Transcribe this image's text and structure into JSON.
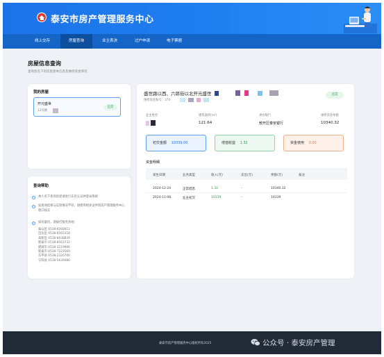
{
  "header": {
    "site_title": "泰安市房产管理服务中心"
  },
  "nav": {
    "items": [
      {
        "label": "线上交存"
      },
      {
        "label": "房屋查询",
        "active": true
      },
      {
        "label": "业主表决"
      },
      {
        "label": "过户申请"
      },
      {
        "label": "电子票据"
      }
    ]
  },
  "page": {
    "title": "房屋信息查询",
    "subtitle": "查询您名下的房屋基本信息及维修资金情况"
  },
  "my_houses": {
    "title": "我的房屋",
    "items": [
      {
        "name": "开元盛世",
        "sub": "12号楼",
        "status": "已交"
      }
    ]
  },
  "help": {
    "title": "查询帮助",
    "tips": [
      "本人名下查询房屋请进行实名认证并登录系统",
      "如查询结果与实际情况不符，请携带相关证件到房产管理服务中心窗口核实",
      "如有疑问，请拨打服务热线："
    ],
    "phones": [
      "泰山区 0538-6268811",
      "岱岳区 0538-8565358",
      "高新区 0538-8938839",
      "新泰市 0538-8563732",
      "肥城市 0538-3219986",
      "新泰市 0538-7223569",
      "东平县 0538-2320766",
      "宁阳县 0538-5639086"
    ]
  },
  "detail": {
    "address": "盛世路以西、六郎街以北开元盛世",
    "account_label": "维修资金账号：370",
    "status": "已交",
    "fields": [
      {
        "label": "业主姓名",
        "value": ""
      },
      {
        "label": "建筑面积(m²)",
        "value": "121.64"
      },
      {
        "label": "承办银行",
        "value": "敖开区泰安银行"
      },
      {
        "label": "维修资金余额",
        "value": "10340.32"
      }
    ],
    "stats": [
      {
        "label": "初交金额",
        "value": "10339.00",
        "color": "#1b73e8"
      },
      {
        "label": "增值收益",
        "value": "1.32",
        "color": "#2b9a4e"
      },
      {
        "label": "资金使用",
        "value": "0.00",
        "color": "#e8753b"
      }
    ]
  },
  "ledger": {
    "title": "资金明细",
    "headers": [
      "发生日期",
      "业务类型",
      "收入(元)",
      "支出(元)",
      "余额(元)",
      "备注"
    ],
    "rows": [
      {
        "date": "2024-12-24",
        "type": "正常结息",
        "income": "1.32",
        "expense": "-",
        "balance": "10340.32",
        "note": ""
      },
      {
        "date": "2024-11-08",
        "type": "业主初交",
        "income": "10339",
        "expense": "-",
        "balance": "10339",
        "note": ""
      }
    ]
  },
  "footer": {
    "copyright": "泰安市房产管理服务中心版权所有2025",
    "watermark": "公众号 · 泰安房产管理"
  }
}
